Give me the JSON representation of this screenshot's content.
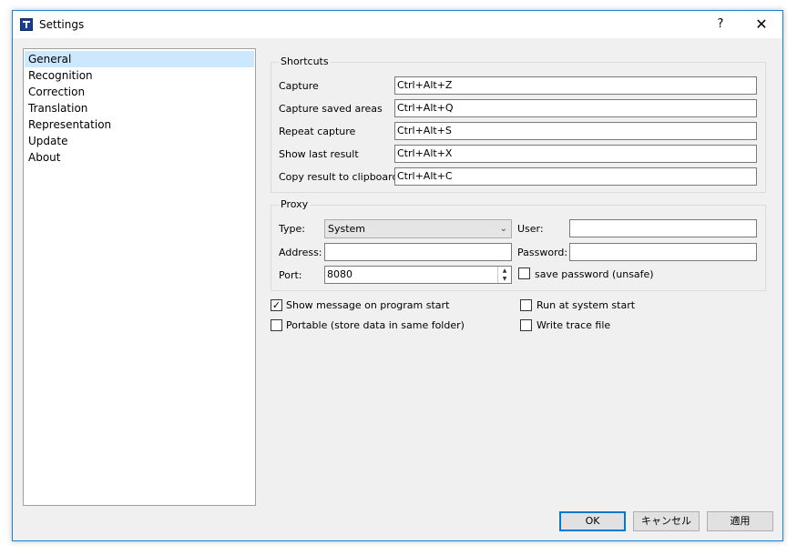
{
  "window": {
    "title": "Settings",
    "help_symbol": "?",
    "close_symbol": "✕"
  },
  "nav": {
    "items": [
      "General",
      "Recognition",
      "Correction",
      "Translation",
      "Representation",
      "Update",
      "About"
    ],
    "selected": "General"
  },
  "shortcuts": {
    "title": "Shortcuts",
    "rows": [
      {
        "label": "Capture",
        "value": "Ctrl+Alt+Z"
      },
      {
        "label": "Capture saved areas",
        "value": "Ctrl+Alt+Q"
      },
      {
        "label": "Repeat capture",
        "value": "Ctrl+Alt+S"
      },
      {
        "label": "Show last result",
        "value": "Ctrl+Alt+X"
      },
      {
        "label": "Copy result to clipboard",
        "value": "Ctrl+Alt+C"
      }
    ]
  },
  "proxy": {
    "title": "Proxy",
    "type_label": "Type:",
    "type_value": "System",
    "address_label": "Address:",
    "address_value": "",
    "port_label": "Port:",
    "port_value": "8080",
    "user_label": "User:",
    "user_value": "",
    "password_label": "Password:",
    "password_value": "",
    "save_password_label": "save password (unsafe)",
    "save_password_checked": false
  },
  "options": {
    "show_message": {
      "label": "Show message on program start",
      "checked": true
    },
    "portable": {
      "label": "Portable (store data in same folder)",
      "checked": false
    },
    "run_at_start": {
      "label": "Run at system start",
      "checked": false
    },
    "write_trace": {
      "label": "Write trace file",
      "checked": false
    }
  },
  "buttons": {
    "ok": "OK",
    "cancel": "キャンセル",
    "apply": "適用"
  },
  "colors": {
    "accent": "#0078d7",
    "selection": "#cce8ff",
    "window_border": "#1883d7"
  }
}
